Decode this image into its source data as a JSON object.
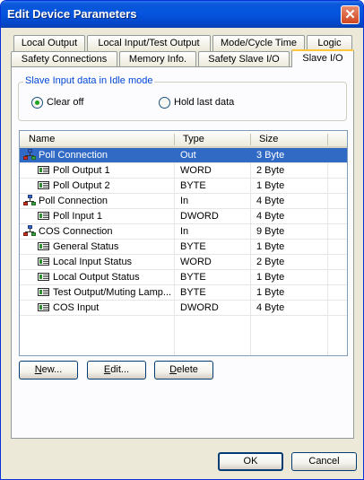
{
  "window": {
    "title": "Edit Device Parameters",
    "close_glyph": "✕"
  },
  "tabs_row1": [
    {
      "label": "Local Output"
    },
    {
      "label": "Local Input/Test Output"
    },
    {
      "label": "Mode/Cycle Time"
    },
    {
      "label": "Logic"
    }
  ],
  "tabs_row2": [
    {
      "label": "Safety Connections"
    },
    {
      "label": "Memory Info."
    },
    {
      "label": "Safety Slave I/O"
    },
    {
      "label": "Slave I/O"
    }
  ],
  "active_tab": "Slave I/O",
  "idle_mode": {
    "legend": "Slave Input data in Idle mode",
    "options": [
      {
        "label": "Clear off",
        "selected": true
      },
      {
        "label": "Hold last data",
        "selected": false
      }
    ]
  },
  "table": {
    "columns": [
      {
        "label": "Name"
      },
      {
        "label": "Type"
      },
      {
        "label": "Size"
      }
    ],
    "rows": [
      {
        "name": "Poll Connection",
        "type": "Out",
        "size": "3 Byte",
        "icon": "connection-icon",
        "selected": true
      },
      {
        "name": "Poll Output 1",
        "type": "WORD",
        "size": "2 Byte",
        "icon": "io-item-icon"
      },
      {
        "name": "Poll Output 2",
        "type": "BYTE",
        "size": "1 Byte",
        "icon": "io-item-icon"
      },
      {
        "name": "Poll Connection",
        "type": "In",
        "size": "4 Byte",
        "icon": "connection-icon"
      },
      {
        "name": "Poll Input 1",
        "type": "DWORD",
        "size": "4 Byte",
        "icon": "io-item-icon"
      },
      {
        "name": "COS Connection",
        "type": "In",
        "size": "9 Byte",
        "icon": "connection-icon"
      },
      {
        "name": "General Status",
        "type": "BYTE",
        "size": "1 Byte",
        "icon": "io-item-icon"
      },
      {
        "name": "Local Input Status",
        "type": "WORD",
        "size": "2 Byte",
        "icon": "io-item-icon"
      },
      {
        "name": "Local Output Status",
        "type": "BYTE",
        "size": "1 Byte",
        "icon": "io-item-icon"
      },
      {
        "name": "Test Output/Muting Lamp...",
        "type": "BYTE",
        "size": "1 Byte",
        "icon": "io-item-icon"
      },
      {
        "name": "COS Input",
        "type": "DWORD",
        "size": "4 Byte",
        "icon": "io-item-icon"
      }
    ]
  },
  "buttons": {
    "new": {
      "mnemonic": "N",
      "rest": "ew..."
    },
    "edit": {
      "mnemonic": "E",
      "rest": "dit..."
    },
    "delete": {
      "mnemonic": "D",
      "rest": "elete"
    },
    "ok": "OK",
    "cancel": "Cancel"
  },
  "colors": {
    "title_bar": "#0655e0",
    "selection": "#316ac5",
    "group_legend": "#0046d5",
    "active_tab_highlight": "#ffc83c"
  }
}
